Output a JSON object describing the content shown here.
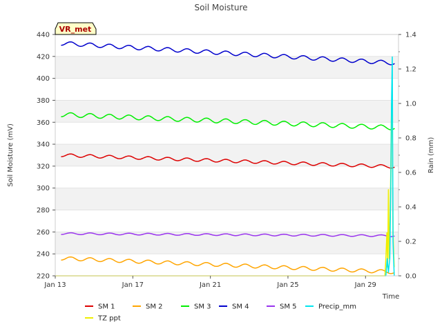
{
  "chart_data": {
    "type": "line",
    "title": "Soil Moisture",
    "badge": "VR_met",
    "xlabel": "Time",
    "ylabel": "Soil Moisture (mV)",
    "y2label": "Rain (mm)",
    "xlim": [
      0,
      17.7
    ],
    "ylim": [
      220,
      440
    ],
    "y2lim": [
      0,
      1.4
    ],
    "x_ticks": [
      {
        "day": 0,
        "label": "Jan 13"
      },
      {
        "day": 4,
        "label": "Jan 17"
      },
      {
        "day": 8,
        "label": "Jan 21"
      },
      {
        "day": 12,
        "label": "Jan 25"
      },
      {
        "day": 16,
        "label": "Jan 29"
      }
    ],
    "y_ticks": [
      220,
      240,
      260,
      280,
      300,
      320,
      340,
      360,
      380,
      400,
      420,
      440
    ],
    "y2_ticks": [
      "0.0",
      "0.2",
      "0.4",
      "0.6",
      "0.8",
      "1.0",
      "1.2",
      "1.4"
    ],
    "grid": "horizontal bands",
    "legend_position": "bottom",
    "series": [
      {
        "name": "SM 1",
        "axis": "left",
        "color": "#dd0000",
        "start_day": 0.3,
        "end_day": 17.5,
        "start": 330,
        "end": 319.5,
        "amplitude": 1.4
      },
      {
        "name": "SM 2",
        "axis": "left",
        "color": "#ffa500",
        "start_day": 0.3,
        "end_day": 17.5,
        "start": 236,
        "end": 223.5,
        "amplitude": 1.6
      },
      {
        "name": "SM 3",
        "axis": "left",
        "color": "#00ee00",
        "start_day": 0.3,
        "end_day": 17.5,
        "start": 367,
        "end": 355,
        "amplitude": 2.0
      },
      {
        "name": "SM 4",
        "axis": "left",
        "color": "#0000cc",
        "start_day": 0.3,
        "end_day": 17.5,
        "start": 432,
        "end": 414,
        "amplitude": 1.8
      },
      {
        "name": "SM 5",
        "axis": "left",
        "color": "#9933ee",
        "start_day": 0.3,
        "end_day": 17.5,
        "start": 258.5,
        "end": 256.5,
        "amplitude": 0.8
      },
      {
        "name": "Precip_mm",
        "axis": "right",
        "color": "#00e5ee",
        "points": [
          [
            17.0,
            0
          ],
          [
            17.05,
            0
          ],
          [
            17.12,
            0.1
          ],
          [
            17.18,
            0.02
          ],
          [
            17.25,
            0.1
          ],
          [
            17.3,
            0.5
          ],
          [
            17.34,
            1.0
          ],
          [
            17.38,
            1.27
          ],
          [
            17.42,
            0.2
          ],
          [
            17.48,
            0
          ]
        ]
      },
      {
        "name": "TZ ppt",
        "axis": "right",
        "color": "#eeee00",
        "points": [
          [
            0.0,
            0
          ],
          [
            16.9,
            0
          ],
          [
            17.0,
            0
          ],
          [
            17.05,
            0.1
          ],
          [
            17.1,
            0.25
          ],
          [
            17.14,
            0.05
          ],
          [
            17.18,
            0.5
          ],
          [
            17.22,
            0.1
          ],
          [
            17.26,
            0.3
          ],
          [
            17.3,
            0.6
          ],
          [
            17.34,
            1.0
          ],
          [
            17.38,
            0.85
          ],
          [
            17.42,
            0.25
          ],
          [
            17.48,
            0.05
          ]
        ]
      }
    ]
  }
}
